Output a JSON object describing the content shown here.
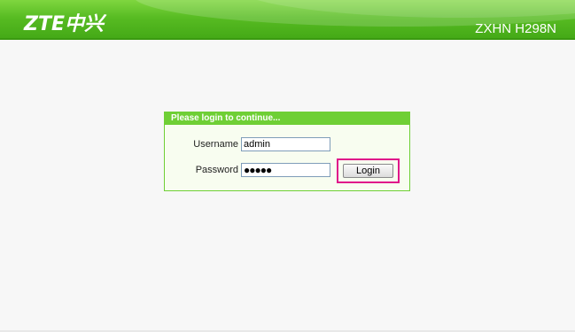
{
  "header": {
    "logo": "ZTE中兴",
    "model": "ZXHN H298N"
  },
  "login": {
    "title": "Please login to continue...",
    "username_label": "Username",
    "username_value": "admin",
    "password_label": "Password",
    "password_value": "●●●●●",
    "login_button": "Login"
  },
  "colors": {
    "brand_green": "#57bb22",
    "highlight": "#e0158a"
  }
}
